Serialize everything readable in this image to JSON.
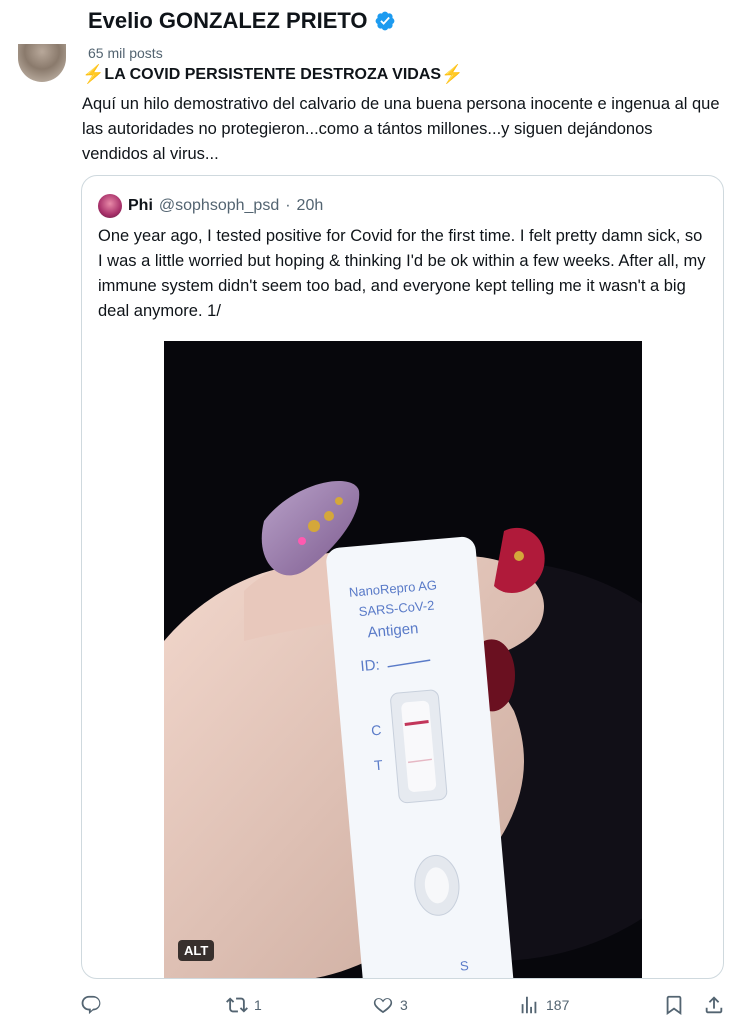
{
  "author": {
    "name": "Evelio GONZALEZ PRIETO",
    "posts_count": "65 mil posts",
    "verified": true
  },
  "post": {
    "title": "LA COVID PERSISTENTE DESTROZA VIDAS",
    "body": "Aquí un hilo demostrativo del calvario de una buena persona inocente e ingenua al que las autoridades no protegieron...como a tántos millones...y siguen dejándonos vendidos al virus..."
  },
  "quote": {
    "name": "Phi",
    "handle": "@sophsoph_psd",
    "separator": "·",
    "time": "20h",
    "text": "One year ago, I tested positive for Covid for the first time. I felt pretty damn sick, so I was a little worried but hoping & thinking I'd be ok within a few weeks. After all, my immune system didn't seem too bad, and everyone kept telling me it wasn't a big deal anymore. 1/",
    "image": {
      "alt_badge": "ALT",
      "test_label_lines": [
        "NanoRepro AG",
        "SARS-CoV-2",
        "Antigen"
      ],
      "id_label": "ID:",
      "c_label": "C",
      "t_label": "T",
      "s_label": "S"
    }
  },
  "actions": {
    "reply_count": "",
    "repost_count": "1",
    "like_count": "3",
    "views_count": "187"
  },
  "colors": {
    "verified": "#1d9bf0",
    "bolt": "#f5b400",
    "muted": "#536471",
    "border": "#cfd9de"
  }
}
